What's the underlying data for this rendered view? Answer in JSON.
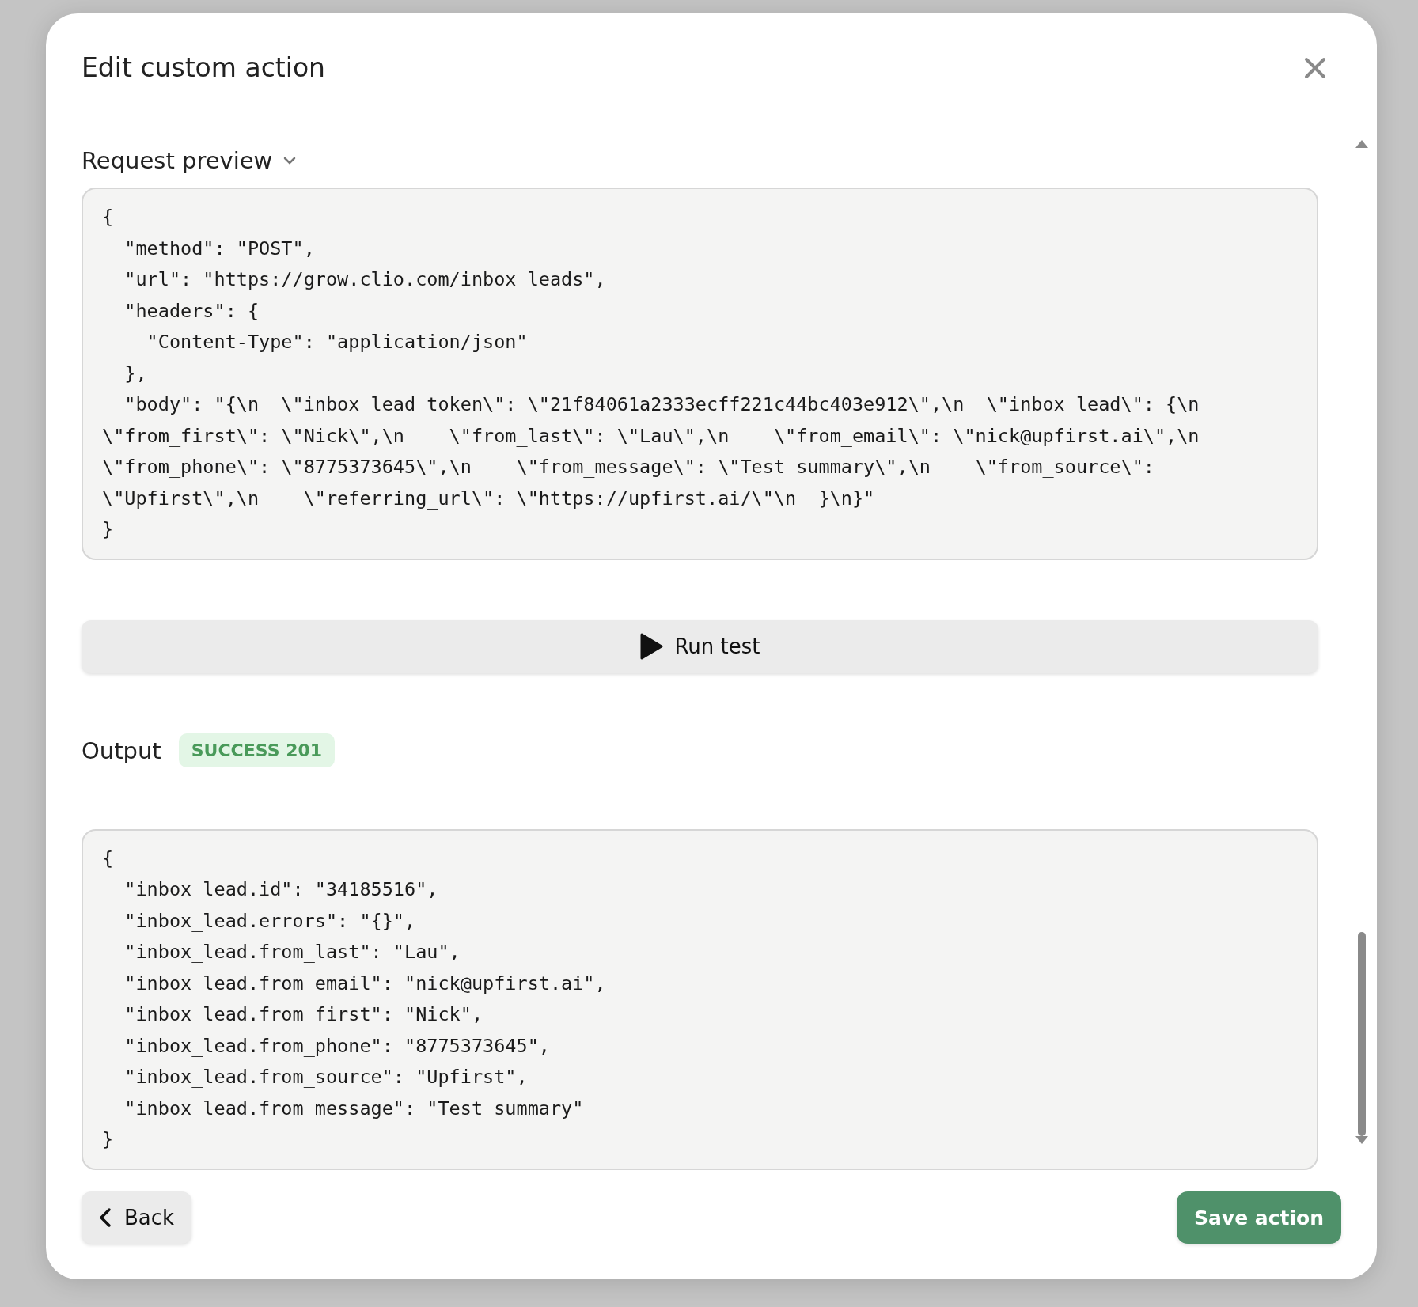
{
  "dialog": {
    "title": "Edit custom action"
  },
  "request_preview": {
    "heading": "Request preview",
    "expanded": true,
    "lines": [
      "{",
      "  \"method\": \"POST\",",
      "  \"url\": \"https://grow.clio.com/inbox_leads\",",
      "  \"headers\": {",
      "    \"Content-Type\": \"application/json\"",
      "  },",
      "  \"body\": \"{\\n  \\\"inbox_lead_token\\\": \\\"21f84061a2333ecff221c44bc403e912\\\",\\n  \\\"inbox_lead\\\": {\\n",
      "\\\"from_first\\\": \\\"Nick\\\",\\n    \\\"from_last\\\": \\\"Lau\\\",\\n    \\\"from_email\\\": \\\"nick@upfirst.ai\\\",\\n",
      "\\\"from_phone\\\": \\\"8775373645\\\",\\n    \\\"from_message\\\": \\\"Test summary\\\",\\n    \\\"from_source\\\":",
      "\\\"Upfirst\\\",\\n    \\\"referring_url\\\": \\\"https://upfirst.ai/\\\"\\n  }\\n}\"",
      "}"
    ]
  },
  "run_button": {
    "label": "Run test"
  },
  "output": {
    "heading": "Output",
    "status": "SUCCESS 201",
    "lines": [
      "{",
      "  \"inbox_lead.id\": \"34185516\",",
      "  \"inbox_lead.errors\": \"{}\",",
      "  \"inbox_lead.from_last\": \"Lau\",",
      "  \"inbox_lead.from_email\": \"nick@upfirst.ai\",",
      "  \"inbox_lead.from_first\": \"Nick\",",
      "  \"inbox_lead.from_phone\": \"8775373645\",",
      "  \"inbox_lead.from_source\": \"Upfirst\",",
      "  \"inbox_lead.from_message\": \"Test summary\"",
      "}"
    ]
  },
  "footer": {
    "back": "Back",
    "save": "Save action"
  }
}
